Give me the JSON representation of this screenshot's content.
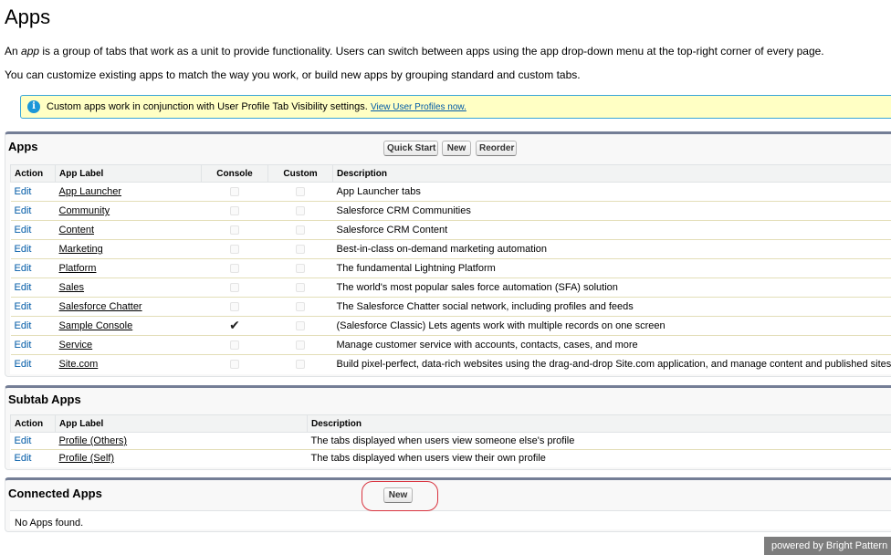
{
  "header": {
    "title": "Apps",
    "intro_prefix": "An ",
    "intro_em": "app",
    "intro_suffix": " is a group of tabs that work as a unit to provide functionality. Users can switch between apps using the app drop-down menu at the top-right corner of every page.",
    "intro2": "You can customize existing apps to match the way you work, or build new apps by grouping standard and custom tabs."
  },
  "info": {
    "icon": "info-icon",
    "text": "Custom apps work in conjunction with User Profile Tab Visibility settings.",
    "link": "View User Profiles now."
  },
  "apps_panel": {
    "title": "Apps",
    "buttons": {
      "quick_start": "Quick Start",
      "new": "New",
      "reorder": "Reorder"
    },
    "columns": {
      "action": "Action",
      "label": "App Label",
      "console": "Console",
      "custom": "Custom",
      "description": "Description"
    },
    "rows": [
      {
        "action": "Edit",
        "label": "App Launcher",
        "console": false,
        "custom": false,
        "description": "App Launcher tabs"
      },
      {
        "action": "Edit",
        "label": "Community",
        "console": false,
        "custom": false,
        "description": "Salesforce CRM Communities"
      },
      {
        "action": "Edit",
        "label": "Content",
        "console": false,
        "custom": false,
        "description": "Salesforce CRM Content"
      },
      {
        "action": "Edit",
        "label": "Marketing",
        "console": false,
        "custom": false,
        "description": "Best-in-class on-demand marketing automation"
      },
      {
        "action": "Edit",
        "label": "Platform",
        "console": false,
        "custom": false,
        "description": "The fundamental Lightning Platform"
      },
      {
        "action": "Edit",
        "label": "Sales",
        "console": false,
        "custom": false,
        "description": "The world's most popular sales force automation (SFA) solution"
      },
      {
        "action": "Edit",
        "label": "Salesforce Chatter",
        "console": false,
        "custom": false,
        "description": "The Salesforce Chatter social network, including profiles and feeds"
      },
      {
        "action": "Edit",
        "label": "Sample Console",
        "console": true,
        "custom": false,
        "description": "(Salesforce Classic) Lets agents work with multiple records on one screen"
      },
      {
        "action": "Edit",
        "label": "Service",
        "console": false,
        "custom": false,
        "description": "Manage customer service with accounts, contacts, cases, and more"
      },
      {
        "action": "Edit",
        "label": "Site.com",
        "console": false,
        "custom": false,
        "description": "Build pixel-perfect, data-rich websites using the drag-and-drop Site.com application, and manage content and published sites."
      }
    ]
  },
  "subtab_panel": {
    "title": "Subtab Apps",
    "columns": {
      "action": "Action",
      "label": "App Label",
      "description": "Description"
    },
    "rows": [
      {
        "action": "Edit",
        "label": "Profile (Others)",
        "description": "The tabs displayed when users view someone else's profile"
      },
      {
        "action": "Edit",
        "label": "Profile (Self)",
        "description": "The tabs displayed when users view their own profile"
      }
    ]
  },
  "connected_panel": {
    "title": "Connected Apps",
    "new_button": "New",
    "empty_text": "No Apps found."
  },
  "footer": {
    "badge": "powered by Bright Pattern"
  },
  "colors": {
    "accent_link": "#015ba7",
    "info_bg": "#ffffc4",
    "panel_border": "#747e96",
    "highlight": "#d9333f"
  }
}
